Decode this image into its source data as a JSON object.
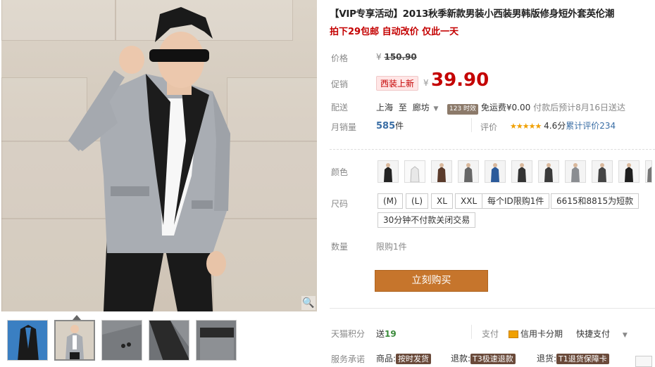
{
  "product": {
    "title": "【VIP专享活动】2013秋季新款男装小西装男韩版修身短外套英伦潮",
    "subtitle": "拍下29包邮 自动改价 仅此一天"
  },
  "price": {
    "label": "价格",
    "currency": "¥",
    "original": "150.90"
  },
  "promo": {
    "label": "促销",
    "tag": "西装上新",
    "currency": "¥",
    "price": "39.90"
  },
  "shipping": {
    "label": "配送",
    "from": "上海",
    "to_word": "至",
    "to": "廊坊",
    "time_badge": "123 时效",
    "fee": "免运费¥0.00",
    "estimate": "付款后预计8月16日送达"
  },
  "sales": {
    "label": "月销量",
    "count": "585",
    "unit": "件",
    "rating_label": "评价",
    "stars": "★★★★★",
    "rating": "4.6分",
    "reviews_text": "累计评价",
    "reviews": "234"
  },
  "color": {
    "label": "颜色",
    "swatch_count": 11
  },
  "size": {
    "label": "尺码",
    "options": [
      "(M)",
      "(L)",
      "XL",
      "XXL",
      "每个ID限购1件",
      "6615和8815为短款",
      "30分钟不付款关闭交易"
    ]
  },
  "quantity": {
    "label": "数量",
    "limit": "限购1件"
  },
  "buy_button": "立刻购买",
  "points": {
    "label": "天猫积分",
    "value_prefix": "送",
    "value": "19"
  },
  "payment": {
    "label": "支付",
    "credit": "信用卡分期",
    "quick": "快捷支付"
  },
  "service": {
    "label": "服务承诺",
    "goods": "商品:",
    "goods_badge": "按时发货",
    "refund": "退款:",
    "refund_badge": "T3极速退款",
    "return": "退货:",
    "return_badge": "T1退货保障卡"
  },
  "colors": {
    "price_red": "#c40000",
    "buy_orange": "#c6752c",
    "star": "#f0a000"
  }
}
